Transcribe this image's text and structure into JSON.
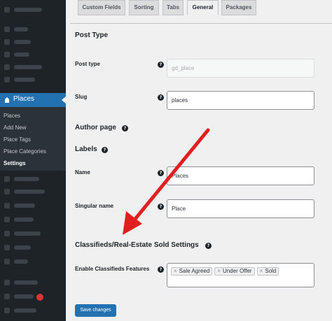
{
  "sidebar": {
    "places_label": "Places",
    "submenu": [
      "Places",
      "Add New",
      "Place Tags",
      "Place Categories",
      "Settings"
    ],
    "current": "Settings"
  },
  "tabs": [
    "Custom Fields",
    "Sorting",
    "Tabs",
    "General",
    "Packages"
  ],
  "active_tab": "General",
  "sections": {
    "post_type": "Post Type",
    "author_page": "Author page",
    "labels": "Labels",
    "classifieds": "Classifieds/Real-Estate Sold Settings"
  },
  "fields": {
    "post_type": {
      "label": "Post type",
      "value": "gd_place"
    },
    "slug": {
      "label": "Slug",
      "value": "places"
    },
    "name": {
      "label": "Name",
      "value": "Places"
    },
    "singular_name": {
      "label": "Singular name",
      "value": "Place"
    },
    "classifieds_features": {
      "label": "Enable Classifieds Features",
      "chips": [
        "Sale Agreed",
        "Under Offer",
        "Sold"
      ]
    }
  },
  "help_icon": "?",
  "chip_remove": "×",
  "save_button": "Save changes",
  "colors": {
    "accent": "#2271b1",
    "sidebar": "#1d2327",
    "annotation": "#e02020"
  }
}
